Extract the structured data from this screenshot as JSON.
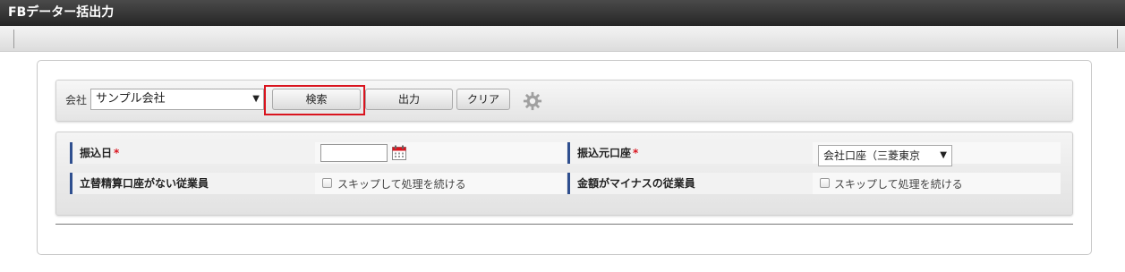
{
  "window": {
    "title": "FBデーター括出力"
  },
  "toolbar": {
    "company_label": "会社",
    "company_value": "サンプル会社",
    "search_label": "検索",
    "output_label": "出力",
    "clear_label": "クリア"
  },
  "form": {
    "transfer_date_label": "振込日",
    "required_mark": "*",
    "source_account_label": "振込元口座",
    "source_account_value": "会社口座（三菱東京",
    "no_reimb_account_label": "立替精算口座がない従業員",
    "negative_amount_label": "金額がマイナスの従業員",
    "skip_label": "スキップして処理を続ける",
    "skip_label2": "スキップして処理を続ける"
  },
  "icons": {
    "gear": "gear-icon",
    "calendar": "calendar-icon",
    "dropdown": "chevron-down-icon"
  },
  "colors": {
    "highlight": "#d9141e",
    "label_accent": "#2f4f8f",
    "title_bg": "#333333"
  }
}
